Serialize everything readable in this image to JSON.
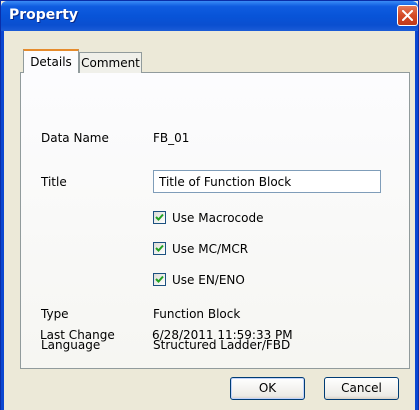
{
  "window": {
    "title": "Property",
    "close_icon": "close-icon"
  },
  "tabs": [
    {
      "label": "Details",
      "active": true
    },
    {
      "label": "Comment",
      "active": false
    }
  ],
  "details": {
    "data_name_label": "Data Name",
    "data_name_value": "FB_01",
    "title_label": "Title",
    "title_value": "Title of Function Block",
    "checkboxes": [
      {
        "label": "Use Macrocode",
        "checked": true
      },
      {
        "label": "Use MC/MCR",
        "checked": true
      },
      {
        "label": "Use EN/ENO",
        "checked": true
      }
    ],
    "type_label": "Type",
    "type_value": "Function Block",
    "language_label": "Language",
    "language_value": "Structured Ladder/FBD",
    "last_change_label": "Last Change",
    "last_change_value": "6/28/2011 11:59:33 PM"
  },
  "buttons": {
    "ok": "OK",
    "cancel": "Cancel"
  },
  "colors": {
    "titlebar": "#0854d8",
    "close_button": "#d44a25",
    "dialog_background": "#ece9d8",
    "active_tab_accent": "#e68b2c"
  }
}
